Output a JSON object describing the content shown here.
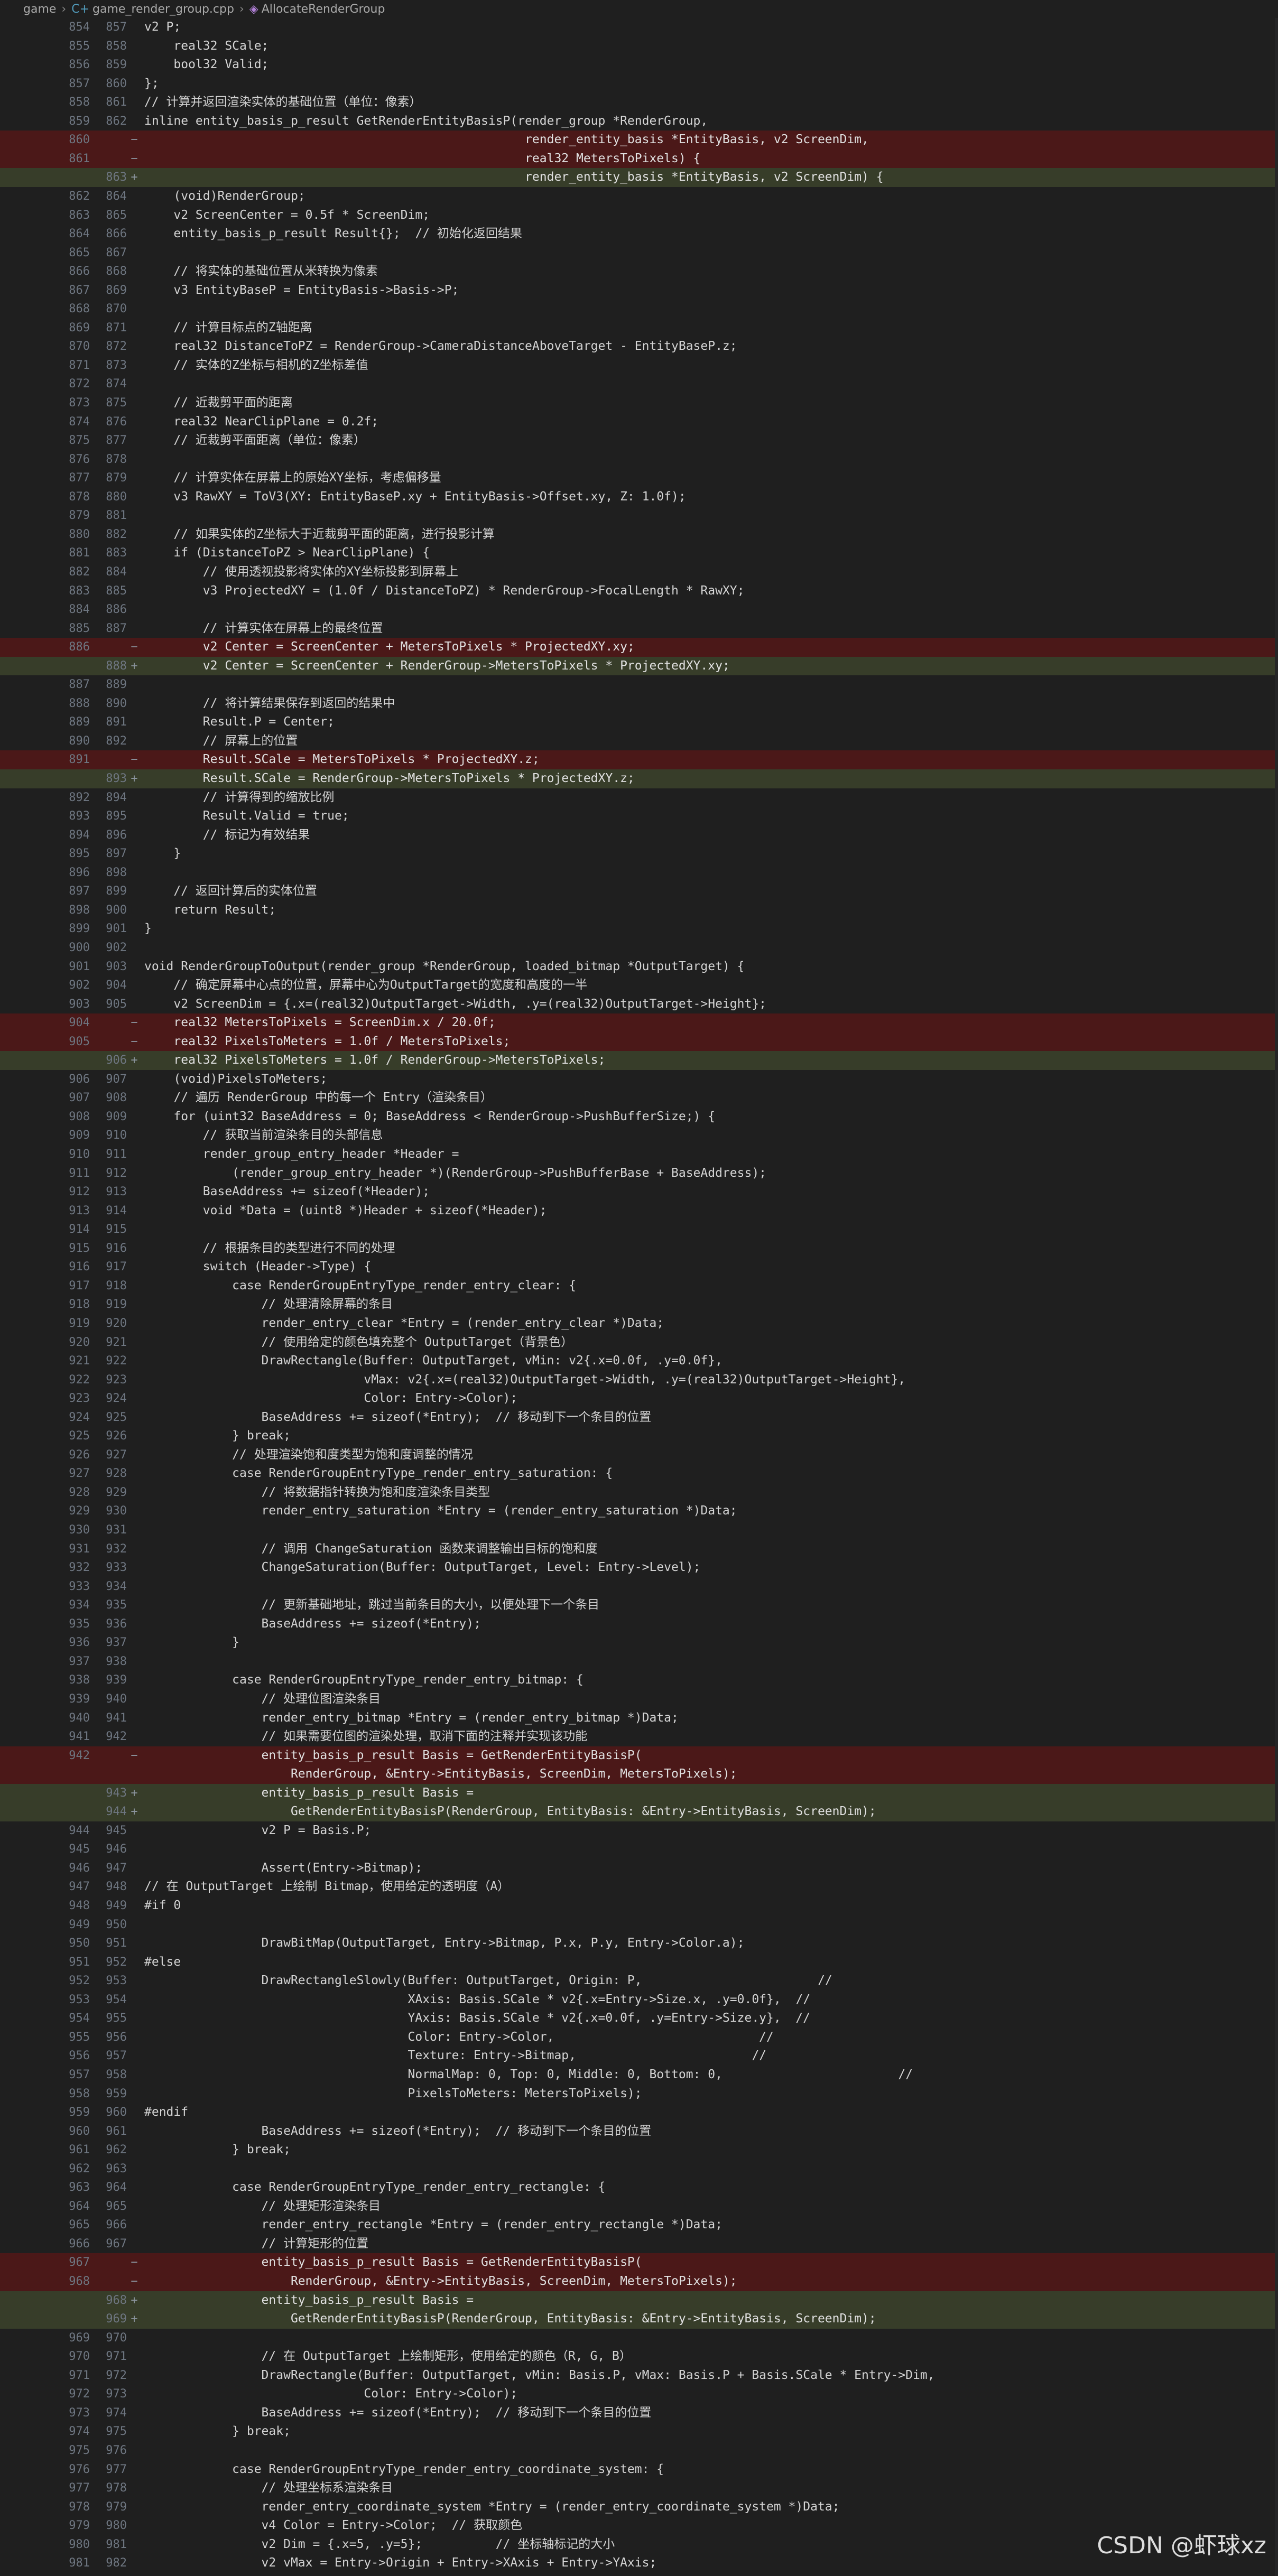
{
  "breadcrumb": {
    "folder": "game",
    "file": "game_render_group.cpp",
    "symbol": "AllocateRenderGroup"
  },
  "watermark": "CSDN @虾球xz",
  "colors": {
    "deleted_line": "#4b1818",
    "added_line": "#373d29",
    "background": "#1f1f1f",
    "keyword": "#569cd6"
  },
  "lines": [
    {
      "o": "854",
      "n": "857",
      "s": "",
      "t": "v2 P;",
      "k": ""
    },
    {
      "o": "855",
      "n": "858",
      "s": "",
      "t": "    real32 SCale;",
      "k": ""
    },
    {
      "o": "856",
      "n": "859",
      "s": "",
      "t": "    bool32 Valid;",
      "k": ""
    },
    {
      "o": "857",
      "n": "860",
      "s": "",
      "t": "};",
      "k": ""
    },
    {
      "o": "858",
      "n": "861",
      "s": "",
      "t": "// 计算并返回渲染实体的基础位置（单位：像素）",
      "k": ""
    },
    {
      "o": "859",
      "n": "862",
      "s": "",
      "t": "inline entity_basis_p_result GetRenderEntityBasisP(render_group *RenderGroup,",
      "k": ""
    },
    {
      "o": "860",
      "n": "",
      "s": "−",
      "t": "                                                    render_entity_basis *EntityBasis, v2 ScreenDim,",
      "k": "del"
    },
    {
      "o": "861",
      "n": "",
      "s": "−",
      "t": "                                                    real32 MetersToPixels) {",
      "k": "del"
    },
    {
      "o": "",
      "n": "863",
      "s": "+",
      "t": "                                                    render_entity_basis *EntityBasis, v2 ScreenDim) {",
      "k": "add"
    },
    {
      "o": "862",
      "n": "864",
      "s": "",
      "t": "    (void)RenderGroup;",
      "k": ""
    },
    {
      "o": "863",
      "n": "865",
      "s": "",
      "t": "    v2 ScreenCenter = 0.5f * ScreenDim;",
      "k": ""
    },
    {
      "o": "864",
      "n": "866",
      "s": "",
      "t": "    entity_basis_p_result Result{};  // 初始化返回结果",
      "k": ""
    },
    {
      "o": "865",
      "n": "867",
      "s": "",
      "t": "",
      "k": ""
    },
    {
      "o": "866",
      "n": "868",
      "s": "",
      "t": "    // 将实体的基础位置从米转换为像素",
      "k": ""
    },
    {
      "o": "867",
      "n": "869",
      "s": "",
      "t": "    v3 EntityBaseP = EntityBasis->Basis->P;",
      "k": ""
    },
    {
      "o": "868",
      "n": "870",
      "s": "",
      "t": "",
      "k": ""
    },
    {
      "o": "869",
      "n": "871",
      "s": "",
      "t": "    // 计算目标点的Z轴距离",
      "k": ""
    },
    {
      "o": "870",
      "n": "872",
      "s": "",
      "t": "    real32 DistanceToPZ = RenderGroup->CameraDistanceAboveTarget - EntityBaseP.z;",
      "k": ""
    },
    {
      "o": "871",
      "n": "873",
      "s": "",
      "t": "    // 实体的Z坐标与相机的Z坐标差值",
      "k": ""
    },
    {
      "o": "872",
      "n": "874",
      "s": "",
      "t": "",
      "k": ""
    },
    {
      "o": "873",
      "n": "875",
      "s": "",
      "t": "    // 近裁剪平面的距离",
      "k": ""
    },
    {
      "o": "874",
      "n": "876",
      "s": "",
      "t": "    real32 NearClipPlane = 0.2f;",
      "k": ""
    },
    {
      "o": "875",
      "n": "877",
      "s": "",
      "t": "    // 近裁剪平面距离（单位：像素）",
      "k": ""
    },
    {
      "o": "876",
      "n": "878",
      "s": "",
      "t": "",
      "k": ""
    },
    {
      "o": "877",
      "n": "879",
      "s": "",
      "t": "    // 计算实体在屏幕上的原始XY坐标，考虑偏移量",
      "k": ""
    },
    {
      "o": "878",
      "n": "880",
      "s": "",
      "t": "    v3 RawXY = ToV3(XY: EntityBaseP.xy + EntityBasis->Offset.xy, Z: 1.0f);",
      "k": ""
    },
    {
      "o": "879",
      "n": "881",
      "s": "",
      "t": "",
      "k": ""
    },
    {
      "o": "880",
      "n": "882",
      "s": "",
      "t": "    // 如果实体的Z坐标大于近裁剪平面的距离，进行投影计算",
      "k": ""
    },
    {
      "o": "881",
      "n": "883",
      "s": "",
      "t": "    if (DistanceToPZ > NearClipPlane) {",
      "k": ""
    },
    {
      "o": "882",
      "n": "884",
      "s": "",
      "t": "        // 使用透视投影将实体的XY坐标投影到屏幕上",
      "k": ""
    },
    {
      "o": "883",
      "n": "885",
      "s": "",
      "t": "        v3 ProjectedXY = (1.0f / DistanceToPZ) * RenderGroup->FocalLength * RawXY;",
      "k": ""
    },
    {
      "o": "884",
      "n": "886",
      "s": "",
      "t": "",
      "k": ""
    },
    {
      "o": "885",
      "n": "887",
      "s": "",
      "t": "        // 计算实体在屏幕上的最终位置",
      "k": ""
    },
    {
      "o": "886",
      "n": "",
      "s": "−",
      "t": "        v2 Center = ScreenCenter + MetersToPixels * ProjectedXY.xy;",
      "k": "del"
    },
    {
      "o": "",
      "n": "888",
      "s": "+",
      "t": "        v2 Center = ScreenCenter + RenderGroup->MetersToPixels * ProjectedXY.xy;",
      "k": "add"
    },
    {
      "o": "887",
      "n": "889",
      "s": "",
      "t": "",
      "k": ""
    },
    {
      "o": "888",
      "n": "890",
      "s": "",
      "t": "        // 将计算结果保存到返回的结果中",
      "k": ""
    },
    {
      "o": "889",
      "n": "891",
      "s": "",
      "t": "        Result.P = Center;",
      "k": ""
    },
    {
      "o": "890",
      "n": "892",
      "s": "",
      "t": "        // 屏幕上的位置",
      "k": ""
    },
    {
      "o": "891",
      "n": "",
      "s": "−",
      "t": "        Result.SCale = MetersToPixels * ProjectedXY.z;",
      "k": "del"
    },
    {
      "o": "",
      "n": "893",
      "s": "+",
      "t": "        Result.SCale = RenderGroup->MetersToPixels * ProjectedXY.z;",
      "k": "add"
    },
    {
      "o": "892",
      "n": "894",
      "s": "",
      "t": "        // 计算得到的缩放比例",
      "k": ""
    },
    {
      "o": "893",
      "n": "895",
      "s": "",
      "t": "        Result.Valid = true;",
      "k": ""
    },
    {
      "o": "894",
      "n": "896",
      "s": "",
      "t": "        // 标记为有效结果",
      "k": ""
    },
    {
      "o": "895",
      "n": "897",
      "s": "",
      "t": "    }",
      "k": ""
    },
    {
      "o": "896",
      "n": "898",
      "s": "",
      "t": "",
      "k": ""
    },
    {
      "o": "897",
      "n": "899",
      "s": "",
      "t": "    // 返回计算后的实体位置",
      "k": ""
    },
    {
      "o": "898",
      "n": "900",
      "s": "",
      "t": "    return Result;",
      "k": ""
    },
    {
      "o": "899",
      "n": "901",
      "s": "",
      "t": "}",
      "k": ""
    },
    {
      "o": "900",
      "n": "902",
      "s": "",
      "t": "",
      "k": ""
    },
    {
      "o": "901",
      "n": "903",
      "s": "",
      "t": "void RenderGroupToOutput(render_group *RenderGroup, loaded_bitmap *OutputTarget) {",
      "k": ""
    },
    {
      "o": "902",
      "n": "904",
      "s": "",
      "t": "    // 确定屏幕中心点的位置，屏幕中心为OutputTarget的宽度和高度的一半",
      "k": ""
    },
    {
      "o": "903",
      "n": "905",
      "s": "",
      "t": "    v2 ScreenDim = {.x=(real32)OutputTarget->Width, .y=(real32)OutputTarget->Height};",
      "k": ""
    },
    {
      "o": "904",
      "n": "",
      "s": "−",
      "t": "    real32 MetersToPixels = ScreenDim.x / 20.0f;",
      "k": "del"
    },
    {
      "o": "905",
      "n": "",
      "s": "−",
      "t": "    real32 PixelsToMeters = 1.0f / MetersToPixels;",
      "k": "del"
    },
    {
      "o": "",
      "n": "906",
      "s": "+",
      "t": "    real32 PixelsToMeters = 1.0f / RenderGroup->MetersToPixels;",
      "k": "add"
    },
    {
      "o": "906",
      "n": "907",
      "s": "",
      "t": "    (void)PixelsToMeters;",
      "k": ""
    },
    {
      "o": "907",
      "n": "908",
      "s": "",
      "t": "    // 遍历 RenderGroup 中的每一个 Entry（渲染条目）",
      "k": ""
    },
    {
      "o": "908",
      "n": "909",
      "s": "",
      "t": "    for (uint32 BaseAddress = 0; BaseAddress < RenderGroup->PushBufferSize;) {",
      "k": ""
    },
    {
      "o": "909",
      "n": "910",
      "s": "",
      "t": "        // 获取当前渲染条目的头部信息",
      "k": ""
    },
    {
      "o": "910",
      "n": "911",
      "s": "",
      "t": "        render_group_entry_header *Header =",
      "k": ""
    },
    {
      "o": "911",
      "n": "912",
      "s": "",
      "t": "            (render_group_entry_header *)(RenderGroup->PushBufferBase + BaseAddress);",
      "k": ""
    },
    {
      "o": "912",
      "n": "913",
      "s": "",
      "t": "        BaseAddress += sizeof(*Header);",
      "k": ""
    },
    {
      "o": "913",
      "n": "914",
      "s": "",
      "t": "        void *Data = (uint8 *)Header + sizeof(*Header);",
      "k": ""
    },
    {
      "o": "914",
      "n": "915",
      "s": "",
      "t": "",
      "k": ""
    },
    {
      "o": "915",
      "n": "916",
      "s": "",
      "t": "        // 根据条目的类型进行不同的处理",
      "k": ""
    },
    {
      "o": "916",
      "n": "917",
      "s": "",
      "t": "        switch (Header->Type) {",
      "k": ""
    },
    {
      "o": "917",
      "n": "918",
      "s": "",
      "t": "            case RenderGroupEntryType_render_entry_clear: {",
      "k": ""
    },
    {
      "o": "918",
      "n": "919",
      "s": "",
      "t": "                // 处理清除屏幕的条目",
      "k": ""
    },
    {
      "o": "919",
      "n": "920",
      "s": "",
      "t": "                render_entry_clear *Entry = (render_entry_clear *)Data;",
      "k": ""
    },
    {
      "o": "920",
      "n": "921",
      "s": "",
      "t": "                // 使用给定的颜色填充整个 OutputTarget（背景色）",
      "k": ""
    },
    {
      "o": "921",
      "n": "922",
      "s": "",
      "t": "                DrawRectangle(Buffer: OutputTarget, vMin: v2{.x=0.0f, .y=0.0f},",
      "k": ""
    },
    {
      "o": "922",
      "n": "923",
      "s": "",
      "t": "                              vMax: v2{.x=(real32)OutputTarget->Width, .y=(real32)OutputTarget->Height},",
      "k": ""
    },
    {
      "o": "923",
      "n": "924",
      "s": "",
      "t": "                              Color: Entry->Color);",
      "k": ""
    },
    {
      "o": "924",
      "n": "925",
      "s": "",
      "t": "                BaseAddress += sizeof(*Entry);  // 移动到下一个条目的位置",
      "k": ""
    },
    {
      "o": "925",
      "n": "926",
      "s": "",
      "t": "            } break;",
      "k": ""
    },
    {
      "o": "926",
      "n": "927",
      "s": "",
      "t": "            // 处理渲染饱和度类型为饱和度调整的情况",
      "k": ""
    },
    {
      "o": "927",
      "n": "928",
      "s": "",
      "t": "            case RenderGroupEntryType_render_entry_saturation: {",
      "k": ""
    },
    {
      "o": "928",
      "n": "929",
      "s": "",
      "t": "                // 将数据指针转换为饱和度渲染条目类型",
      "k": ""
    },
    {
      "o": "929",
      "n": "930",
      "s": "",
      "t": "                render_entry_saturation *Entry = (render_entry_saturation *)Data;",
      "k": ""
    },
    {
      "o": "930",
      "n": "931",
      "s": "",
      "t": "",
      "k": ""
    },
    {
      "o": "931",
      "n": "932",
      "s": "",
      "t": "                // 调用 ChangeSaturation 函数来调整输出目标的饱和度",
      "k": ""
    },
    {
      "o": "932",
      "n": "933",
      "s": "",
      "t": "                ChangeSaturation(Buffer: OutputTarget, Level: Entry->Level);",
      "k": ""
    },
    {
      "o": "933",
      "n": "934",
      "s": "",
      "t": "",
      "k": ""
    },
    {
      "o": "934",
      "n": "935",
      "s": "",
      "t": "                // 更新基础地址，跳过当前条目的大小，以便处理下一个条目",
      "k": ""
    },
    {
      "o": "935",
      "n": "936",
      "s": "",
      "t": "                BaseAddress += sizeof(*Entry);",
      "k": ""
    },
    {
      "o": "936",
      "n": "937",
      "s": "",
      "t": "            }",
      "k": ""
    },
    {
      "o": "937",
      "n": "938",
      "s": "",
      "t": "",
      "k": ""
    },
    {
      "o": "938",
      "n": "939",
      "s": "",
      "t": "            case RenderGroupEntryType_render_entry_bitmap: {",
      "k": ""
    },
    {
      "o": "939",
      "n": "940",
      "s": "",
      "t": "                // 处理位图渲染条目",
      "k": ""
    },
    {
      "o": "940",
      "n": "941",
      "s": "",
      "t": "                render_entry_bitmap *Entry = (render_entry_bitmap *)Data;",
      "k": ""
    },
    {
      "o": "941",
      "n": "942",
      "s": "",
      "t": "                // 如果需要位图的渲染处理，取消下面的注释并实现该功能",
      "k": ""
    },
    {
      "o": "942",
      "n": "",
      "s": "−",
      "t": "                entity_basis_p_result Basis = GetRenderEntityBasisP(",
      "k": "del"
    },
    {
      "o": "",
      "n": "",
      "s": "",
      "t": "                    RenderGroup, &Entry->EntityBasis, ScreenDim, MetersToPixels);",
      "k": "del"
    },
    {
      "o": "",
      "n": "943",
      "s": "+",
      "t": "                entity_basis_p_result Basis =",
      "k": "add"
    },
    {
      "o": "",
      "n": "944",
      "s": "+",
      "t": "                    GetRenderEntityBasisP(RenderGroup, EntityBasis: &Entry->EntityBasis, ScreenDim);",
      "k": "add"
    },
    {
      "o": "944",
      "n": "945",
      "s": "",
      "t": "                v2 P = Basis.P;",
      "k": ""
    },
    {
      "o": "945",
      "n": "946",
      "s": "",
      "t": "",
      "k": ""
    },
    {
      "o": "946",
      "n": "947",
      "s": "",
      "t": "                Assert(Entry->Bitmap);",
      "k": ""
    },
    {
      "o": "947",
      "n": "948",
      "s": "",
      "t": "// 在 OutputTarget 上绘制 Bitmap，使用给定的透明度（A）",
      "k": ""
    },
    {
      "o": "948",
      "n": "949",
      "s": "",
      "t": "#if 0",
      "k": ""
    },
    {
      "o": "949",
      "n": "950",
      "s": "",
      "t": "",
      "k": ""
    },
    {
      "o": "950",
      "n": "951",
      "s": "",
      "t": "                DrawBitMap(OutputTarget, Entry->Bitmap, P.x, P.y, Entry->Color.a);",
      "k": ""
    },
    {
      "o": "951",
      "n": "952",
      "s": "",
      "t": "#else",
      "k": ""
    },
    {
      "o": "952",
      "n": "953",
      "s": "",
      "t": "                DrawRectangleSlowly(Buffer: OutputTarget, Origin: P,                        //",
      "k": ""
    },
    {
      "o": "953",
      "n": "954",
      "s": "",
      "t": "                                    XAxis: Basis.SCale * v2{.x=Entry->Size.x, .y=0.0f},  //",
      "k": ""
    },
    {
      "o": "954",
      "n": "955",
      "s": "",
      "t": "                                    YAxis: Basis.SCale * v2{.x=0.0f, .y=Entry->Size.y},  //",
      "k": ""
    },
    {
      "o": "955",
      "n": "956",
      "s": "",
      "t": "                                    Color: Entry->Color,                            //",
      "k": ""
    },
    {
      "o": "956",
      "n": "957",
      "s": "",
      "t": "                                    Texture: Entry->Bitmap,                        //",
      "k": ""
    },
    {
      "o": "957",
      "n": "958",
      "s": "",
      "t": "                                    NormalMap: 0, Top: 0, Middle: 0, Bottom: 0,                        //",
      "k": ""
    },
    {
      "o": "958",
      "n": "959",
      "s": "",
      "t": "                                    PixelsToMeters: MetersToPixels);",
      "k": ""
    },
    {
      "o": "959",
      "n": "960",
      "s": "",
      "t": "#endif",
      "k": ""
    },
    {
      "o": "960",
      "n": "961",
      "s": "",
      "t": "                BaseAddress += sizeof(*Entry);  // 移动到下一个条目的位置",
      "k": ""
    },
    {
      "o": "961",
      "n": "962",
      "s": "",
      "t": "            } break;",
      "k": ""
    },
    {
      "o": "962",
      "n": "963",
      "s": "",
      "t": "",
      "k": ""
    },
    {
      "o": "963",
      "n": "964",
      "s": "",
      "t": "            case RenderGroupEntryType_render_entry_rectangle: {",
      "k": ""
    },
    {
      "o": "964",
      "n": "965",
      "s": "",
      "t": "                // 处理矩形渲染条目",
      "k": ""
    },
    {
      "o": "965",
      "n": "966",
      "s": "",
      "t": "                render_entry_rectangle *Entry = (render_entry_rectangle *)Data;",
      "k": ""
    },
    {
      "o": "966",
      "n": "967",
      "s": "",
      "t": "                // 计算矩形的位置",
      "k": ""
    },
    {
      "o": "967",
      "n": "",
      "s": "−",
      "t": "                entity_basis_p_result Basis = GetRenderEntityBasisP(",
      "k": "del"
    },
    {
      "o": "968",
      "n": "",
      "s": "−",
      "t": "                    RenderGroup, &Entry->EntityBasis, ScreenDim, MetersToPixels);",
      "k": "del"
    },
    {
      "o": "",
      "n": "968",
      "s": "+",
      "t": "                entity_basis_p_result Basis =",
      "k": "add"
    },
    {
      "o": "",
      "n": "969",
      "s": "+",
      "t": "                    GetRenderEntityBasisP(RenderGroup, EntityBasis: &Entry->EntityBasis, ScreenDim);",
      "k": "add"
    },
    {
      "o": "969",
      "n": "970",
      "s": "",
      "t": "",
      "k": ""
    },
    {
      "o": "970",
      "n": "971",
      "s": "",
      "t": "                // 在 OutputTarget 上绘制矩形，使用给定的颜色（R, G, B）",
      "k": ""
    },
    {
      "o": "971",
      "n": "972",
      "s": "",
      "t": "                DrawRectangle(Buffer: OutputTarget, vMin: Basis.P, vMax: Basis.P + Basis.SCale * Entry->Dim,",
      "k": ""
    },
    {
      "o": "972",
      "n": "973",
      "s": "",
      "t": "                              Color: Entry->Color);",
      "k": ""
    },
    {
      "o": "973",
      "n": "974",
      "s": "",
      "t": "                BaseAddress += sizeof(*Entry);  // 移动到下一个条目的位置",
      "k": ""
    },
    {
      "o": "974",
      "n": "975",
      "s": "",
      "t": "            } break;",
      "k": ""
    },
    {
      "o": "975",
      "n": "976",
      "s": "",
      "t": "",
      "k": ""
    },
    {
      "o": "976",
      "n": "977",
      "s": "",
      "t": "            case RenderGroupEntryType_render_entry_coordinate_system: {",
      "k": ""
    },
    {
      "o": "977",
      "n": "978",
      "s": "",
      "t": "                // 处理坐标系渲染条目",
      "k": ""
    },
    {
      "o": "978",
      "n": "979",
      "s": "",
      "t": "                render_entry_coordinate_system *Entry = (render_entry_coordinate_system *)Data;",
      "k": ""
    },
    {
      "o": "979",
      "n": "980",
      "s": "",
      "t": "                v4 Color = Entry->Color;  // 获取颜色",
      "k": ""
    },
    {
      "o": "980",
      "n": "981",
      "s": "",
      "t": "                v2 Dim = {.x=5, .y=5};          // 坐标轴标记的大小",
      "k": ""
    },
    {
      "o": "981",
      "n": "982",
      "s": "",
      "t": "                v2 vMax = Entry->Origin + Entry->XAxis + Entry->YAxis;",
      "k": ""
    }
  ]
}
